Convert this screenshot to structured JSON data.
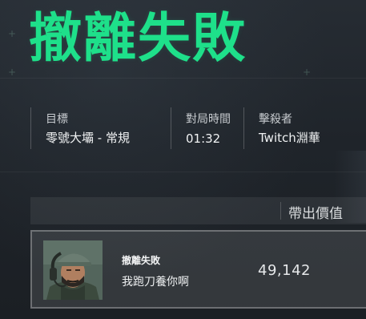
{
  "result": {
    "title": "撤離失敗"
  },
  "info": {
    "target_label": "目標",
    "target_value": "零號大壩 - 常規",
    "time_label": "對局時間",
    "time_value": "01:32",
    "killer_label": "擊殺者",
    "killer_value": "Twitch淵華"
  },
  "table": {
    "header_value_label": "帶出價值",
    "rows": [
      {
        "status": "撤離失敗",
        "player_name": "我跑刀養你啊",
        "value": "49,142"
      }
    ]
  },
  "colors": {
    "title_green": "#1ee08a",
    "background": "#20252b"
  }
}
